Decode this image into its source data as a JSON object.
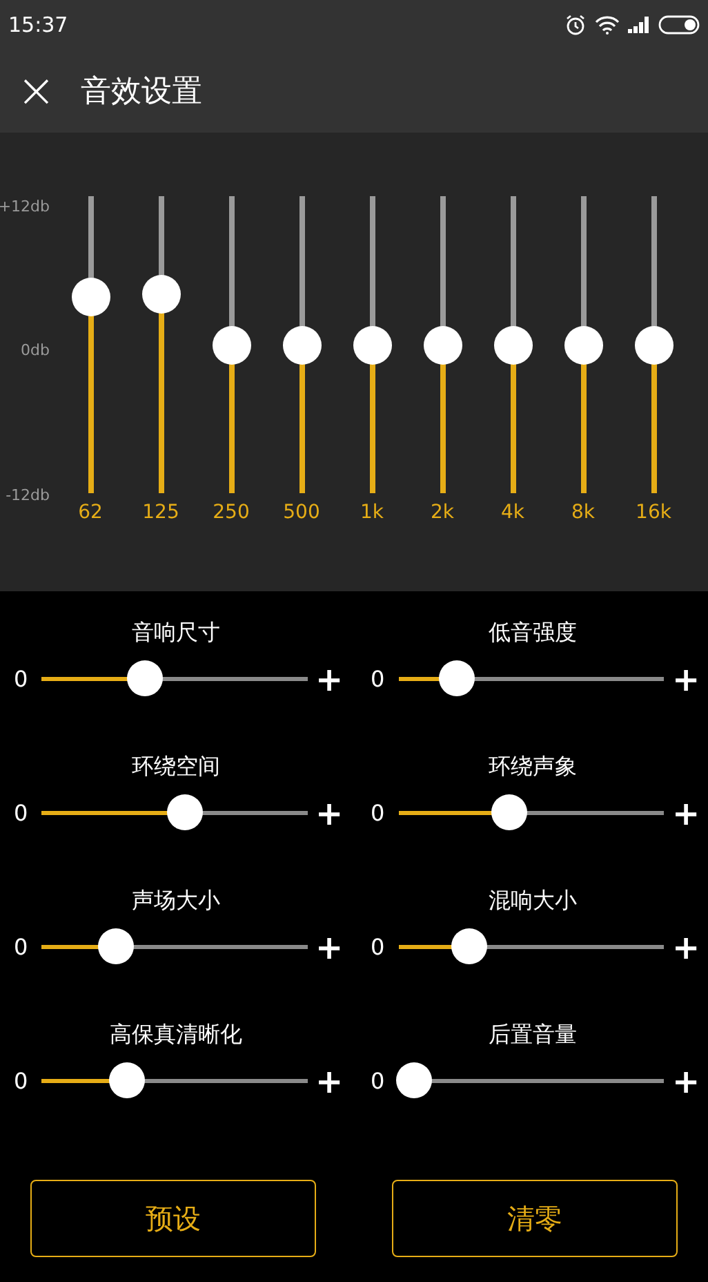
{
  "status_bar": {
    "time": "15:37"
  },
  "header": {
    "close": "×",
    "title": "音效设置"
  },
  "equalizer": {
    "scale": [
      "+12db",
      "0db",
      "-12db"
    ],
    "bands": [
      {
        "label": "62",
        "level": 0.66
      },
      {
        "label": "125",
        "level": 0.67
      },
      {
        "label": "250",
        "level": 0.5
      },
      {
        "label": "500",
        "level": 0.5
      },
      {
        "label": "1k",
        "level": 0.5
      },
      {
        "label": "2k",
        "level": 0.5
      },
      {
        "label": "4k",
        "level": 0.5
      },
      {
        "label": "8k",
        "level": 0.5
      },
      {
        "label": "16k",
        "level": 0.5
      }
    ]
  },
  "effects": [
    {
      "label": "音响尺寸",
      "min": "0",
      "max": "+",
      "level": 0.39
    },
    {
      "label": "低音强度",
      "min": "0",
      "max": "+",
      "level": 0.22
    },
    {
      "label": "环绕空间",
      "min": "0",
      "max": "+",
      "level": 0.54
    },
    {
      "label": "环绕声象",
      "min": "0",
      "max": "+",
      "level": 0.42
    },
    {
      "label": "声场大小",
      "min": "0",
      "max": "+",
      "level": 0.28
    },
    {
      "label": "混响大小",
      "min": "0",
      "max": "+",
      "level": 0.27
    },
    {
      "label": "高保真清晰化",
      "min": "0",
      "max": "+",
      "level": 0.32
    },
    {
      "label": "后置音量",
      "min": "0",
      "max": "+",
      "level": 0.06
    }
  ],
  "buttons": [
    "预设",
    "清零"
  ]
}
